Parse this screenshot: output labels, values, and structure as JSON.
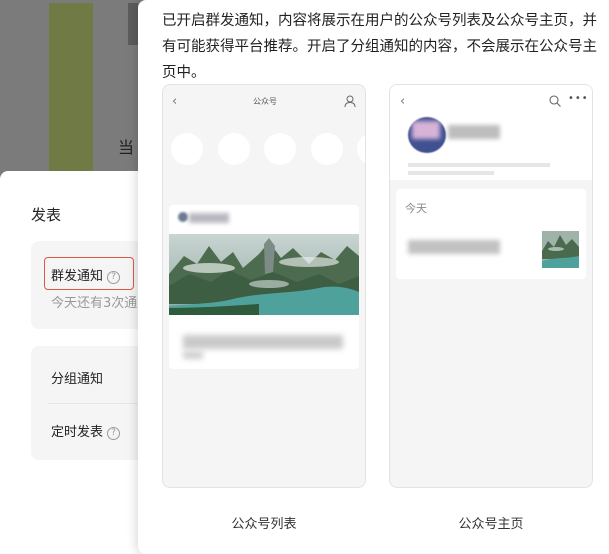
{
  "background": {
    "partial_text": "当",
    "panel": {
      "title": "发表",
      "mass_notice_label": "群发通知",
      "remaining_text": "今天还有3次通",
      "group_notice_label": "分组通知",
      "scheduled_post_label": "定时发表",
      "help_icon_glyph": "?"
    }
  },
  "popover": {
    "description": "已开启群发通知，内容将展示在用户的公众号列表及公众号主页，并有可能获得平台推荐。开启了分组通知的内容，不会展示在公众号主页中。",
    "left_preview": {
      "nav_title": "公众号",
      "caption": "公众号列表"
    },
    "right_preview": {
      "section_label": "今天",
      "caption": "公众号主页"
    }
  },
  "icons": {
    "back": "chevron-left-icon",
    "user": "user-icon",
    "search": "search-icon",
    "more": "more-dots-icon",
    "help": "question-circle-icon"
  },
  "colors": {
    "overlay": "#7b7b7b",
    "highlight_border": "#e0554a",
    "muted_text": "#999999",
    "phone_bg": "#f5f5f5"
  }
}
